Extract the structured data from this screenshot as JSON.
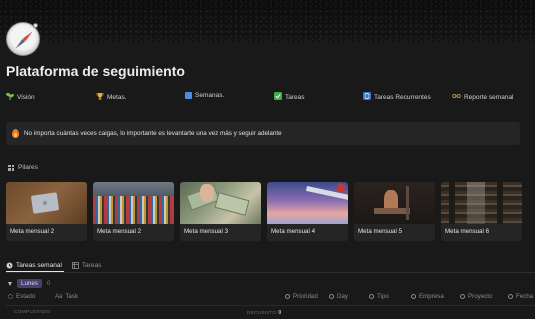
{
  "page": {
    "title": "Plataforma de seguimiento"
  },
  "links": [
    {
      "label": "Visión",
      "icon": "seedling-icon",
      "color": "#7cc04a"
    },
    {
      "label": "Metas.",
      "icon": "trophy-icon",
      "color": "#e2b53a"
    },
    {
      "label": "Semanas.",
      "icon": "number-box-icon",
      "color": "#4a90d9"
    },
    {
      "label": "Tareas",
      "icon": "check-box-icon",
      "color": "#3fae49"
    },
    {
      "label": "Tareas Recurrentes",
      "icon": "repeat-icon",
      "color": "#3a78c9"
    },
    {
      "label": "Reporte semanal",
      "icon": "glasses-icon",
      "color": "#c9a55a"
    }
  ],
  "callout": {
    "icon": "flame-icon",
    "text": "No importa cuántas veces caigas, lo importante es levantarte una vez más y seguir adelante"
  },
  "pilares": {
    "label": "Pilares",
    "cards": [
      {
        "caption": "Meta mensual 2",
        "image": "laptop-on-wood"
      },
      {
        "caption": "Meta mensual 2",
        "image": "marathon-crowd"
      },
      {
        "caption": "Meta mensual 3",
        "image": "dollar-bills"
      },
      {
        "caption": "Meta mensual 4",
        "image": "airplane-wing-sunset"
      },
      {
        "caption": "Meta mensual 5",
        "image": "gym-workout"
      },
      {
        "caption": "Meta mensual 6",
        "image": "library-shelves"
      }
    ]
  },
  "tabs": [
    {
      "label": "Tareas semanal",
      "active": true
    },
    {
      "label": "Tareas",
      "active": false
    }
  ],
  "group": {
    "label": "Lunes",
    "count": "0"
  },
  "properties": [
    {
      "label": "Estado",
      "icon": "status-icon"
    },
    {
      "label": "Task",
      "icon": "text-aa-icon"
    },
    {
      "label": "Prioridad",
      "icon": "select-icon"
    },
    {
      "label": "Day",
      "icon": "select-icon"
    },
    {
      "label": "Tipo",
      "icon": "select-icon"
    },
    {
      "label": "Empresa",
      "icon": "select-icon"
    },
    {
      "label": "Proyecto",
      "icon": "select-icon"
    },
    {
      "label": "Fecha",
      "icon": "clock-icon"
    }
  ],
  "footer": {
    "left": "COMPLETADO",
    "right_label": "RECUENTO",
    "right_value": "0"
  }
}
